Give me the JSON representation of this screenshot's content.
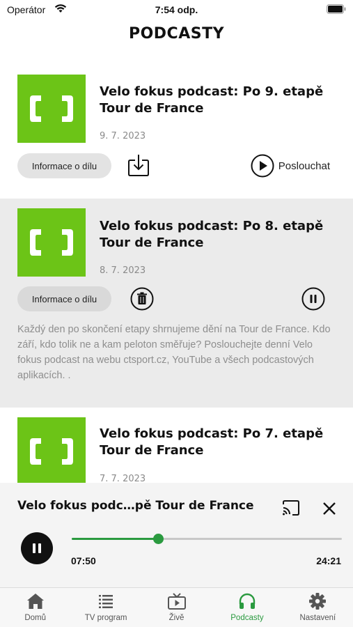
{
  "status_bar": {
    "carrier": "Operátor",
    "time": "7:54 odp."
  },
  "nav": {
    "title": "PODCASTY"
  },
  "episodes": [
    {
      "title": "Velo fokus podcast: Po 9. etapě Tour de France",
      "date": "9. 7. 2023",
      "info_label": "Informace o dílu",
      "action_icon": "download-icon",
      "play_label": "Poslouchat",
      "state": "not-playing"
    },
    {
      "title": "Velo fokus podcast: Po 8. etapě Tour de France",
      "date": "8. 7. 2023",
      "info_label": "Informace o dílu",
      "action_icon": "trash-icon",
      "state": "playing",
      "description": "Každý den po skončení etapy shrnujeme dění na Tour de France. Kdo září, kdo tolik ne a kam peloton směřuje? Poslouchejte denní Velo fokus podcast na webu ctsport.cz, YouTube a všech podcastových aplikacích. ."
    },
    {
      "title": "Velo fokus podcast: Po 7. etapě Tour de France",
      "date": "7. 7. 2023"
    }
  ],
  "player": {
    "title": "Velo fokus podc…pě Tour de France",
    "current_time": "07:50",
    "total_time": "24:21",
    "progress": 0.32,
    "accent": "#2a9a3f"
  },
  "tabbar": {
    "items": [
      {
        "label": "Domů",
        "icon": "home-icon"
      },
      {
        "label": "TV program",
        "icon": "list-icon"
      },
      {
        "label": "Živě",
        "icon": "tv-icon"
      },
      {
        "label": "Podcasty",
        "icon": "headphones-icon",
        "active": true
      },
      {
        "label": "Nastavení",
        "icon": "gear-icon"
      }
    ]
  },
  "colors": {
    "logo_green": "#6cc417",
    "accent_green": "#2a9a3f",
    "active_row_bg": "#ebebeb"
  }
}
